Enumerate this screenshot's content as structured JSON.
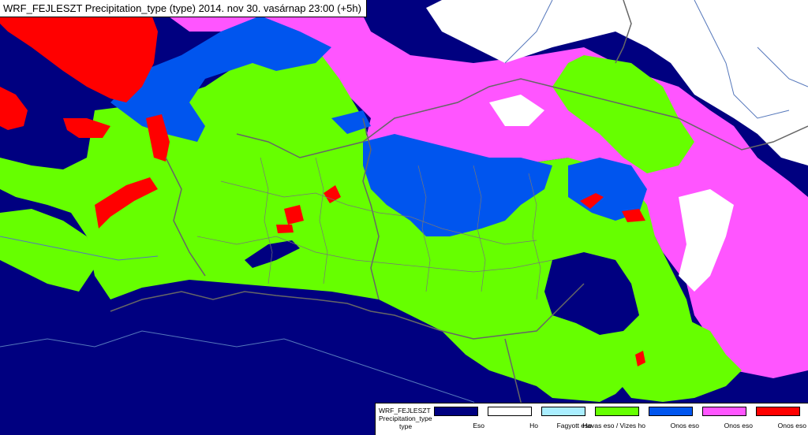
{
  "title": "WRF_FEJLESZT Precipitation_type (type) 2014. nov 30. vasárnap 23:00 (+5h)",
  "legend": {
    "head": [
      "WRF_FEJLESZT",
      "Precipitation_type",
      "type"
    ],
    "items": [
      {
        "label": "Eso",
        "color": "#000080"
      },
      {
        "label": "Ho",
        "color": "#ffffff"
      },
      {
        "label": "Fagyott eso",
        "color": "#aaeeff"
      },
      {
        "label": "Havas eso / Vizes ho",
        "color": "#66ff00"
      },
      {
        "label": "Onos eso",
        "color": "#0055ee"
      },
      {
        "label": "Onos eso",
        "color": "#ff55ff"
      },
      {
        "label": "Onos eso",
        "color": "#ff0000"
      }
    ]
  },
  "map_colors": {
    "rain": "#000080",
    "snow": "#ffffff",
    "sleet": "#66ff00",
    "blue": "#0055ee",
    "magenta": "#ff55ff",
    "red": "#ff0000",
    "border": "#666666",
    "river": "#5577bb"
  }
}
